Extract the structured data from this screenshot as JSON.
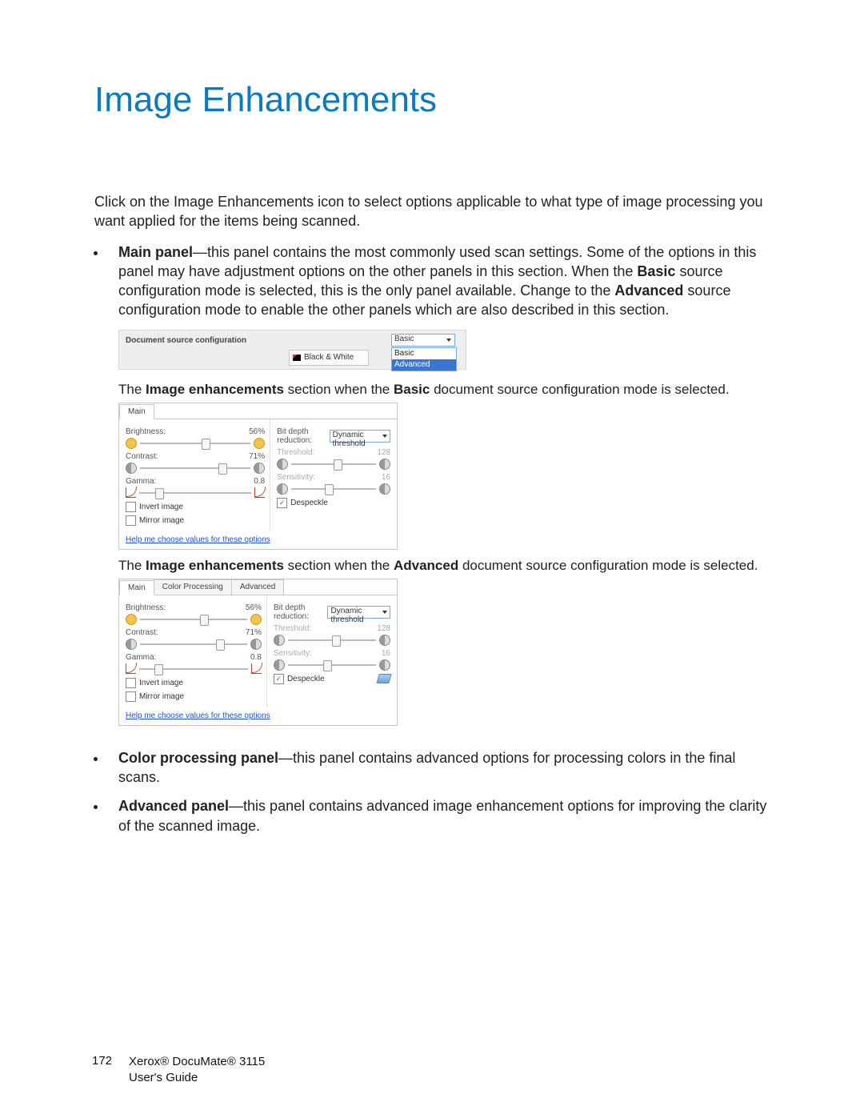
{
  "title": "Image Enhancements",
  "intro": "Click on the Image Enhancements icon to select options applicable to what type of image processing you want applied for the items being scanned.",
  "bullets": {
    "main": {
      "lead": "Main panel",
      "text": "—this panel contains the most commonly used scan settings. Some of the options in this panel may have adjustment options on the other panels in this section. When the ",
      "bold1": "Basic",
      "text2": " source configuration mode is selected, this is the only panel available. Change to the ",
      "bold2": "Advanced",
      "text3": " source configuration mode to enable the other panels which are also described in this section."
    },
    "color": {
      "lead": "Color processing panel",
      "text": "—this panel contains advanced options for processing colors in the final scans."
    },
    "adv": {
      "lead": "Advanced panel",
      "text": "—this panel contains advanced image enhancement options for improving the clarity of the scanned image."
    }
  },
  "ss1": {
    "label": "Document source configuration",
    "tab_bw": "Black & White",
    "dropdown_value": "Basic",
    "options": {
      "basic": "Basic",
      "advanced": "Advanced"
    }
  },
  "caption1": {
    "pre": "The ",
    "b1": "Image enhancements",
    "mid": " section when the ",
    "b2": "Basic",
    "post": " document source configuration mode is selected."
  },
  "caption2": {
    "pre": "The ",
    "b1": "Image enhancements",
    "mid": " section when the ",
    "b2": "Advanced",
    "post": " document source configuration mode is selected."
  },
  "panel": {
    "tabs": {
      "main": "Main",
      "color": "Color Processing",
      "advanced": "Advanced"
    },
    "left": {
      "brightness_label": "Brightness:",
      "brightness_val": "56%",
      "contrast_label": "Contrast:",
      "contrast_val": "71%",
      "gamma_label": "Gamma:",
      "gamma_val": "0.8",
      "invert": "Invert image",
      "mirror": "Mirror image"
    },
    "right": {
      "bdr_label": "Bit depth reduction:",
      "bdr_value": "Dynamic threshold",
      "threshold_label": "Threshold:",
      "threshold_val": "128",
      "sens_label": "Sensitivity:",
      "sens_val": "16",
      "despeckle": "Despeckle"
    },
    "help": "Help me choose values for these options"
  },
  "footer": {
    "page": "172",
    "line1": "Xerox® DocuMate® 3115",
    "line2": "User's Guide"
  }
}
